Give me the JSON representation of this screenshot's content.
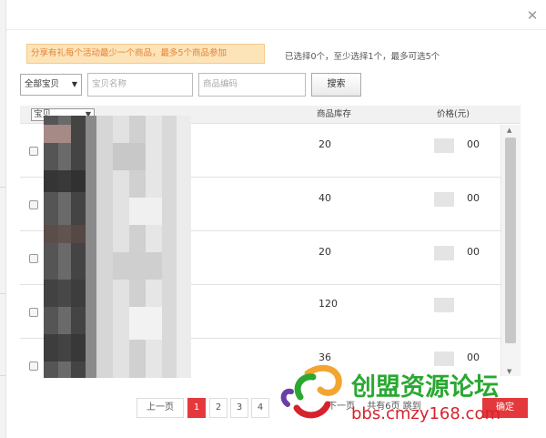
{
  "dialog": {
    "close_icon": "close-icon",
    "notice": "分享有礼每个活动最少一个商品，最多5个商品参加",
    "selected_info": "已选择0个，至少选择1个，最多可选5个"
  },
  "filters": {
    "category_select": "全部宝贝",
    "name_placeholder": "宝贝名称",
    "code_placeholder": "商品编码",
    "search_label": "搜索"
  },
  "table": {
    "headers": {
      "item": "宝贝",
      "stock": "商品库存",
      "price": "价格(元)"
    },
    "rows": [
      {
        "stock": "20",
        "price": "00"
      },
      {
        "stock": "40",
        "price": "00"
      },
      {
        "stock": "20",
        "price": "00"
      },
      {
        "stock": "120",
        "price": ""
      },
      {
        "stock": "36",
        "price": "00"
      }
    ]
  },
  "pager": {
    "prev_label": "上一页",
    "pages": [
      "1",
      "2",
      "3",
      "4"
    ],
    "next_label": "下一页",
    "total_label": "共有6页 跳到",
    "confirm_label": "确定"
  },
  "watermark": {
    "text": "创盟资源论坛",
    "url": "bbs.cmzy168.com"
  },
  "colors": {
    "accent": "#e4393c",
    "notice_bg": "#fde3b8",
    "notice_text": "#e2833b",
    "watermark_text": "#2aa832"
  }
}
